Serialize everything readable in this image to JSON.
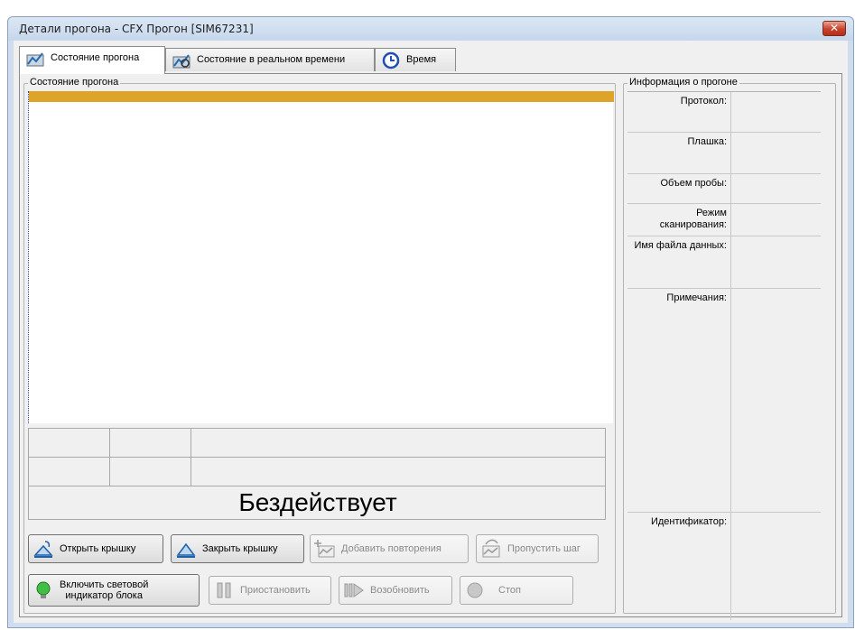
{
  "window": {
    "title": "Детали прогона - CFX Прогон [SIM67231]",
    "close_glyph": "✕"
  },
  "tabs": [
    {
      "label": "Состояние прогона",
      "icon": "run-status-icon",
      "active": true
    },
    {
      "label": "Состояние в реальном времени",
      "icon": "realtime-status-icon",
      "active": false
    },
    {
      "label": "Время",
      "icon": "clock-icon",
      "active": false
    }
  ],
  "status_group": {
    "title": "Состояние прогона",
    "bar_color": "#dea42a",
    "state_text": "Бездействует"
  },
  "buttons": {
    "open_lid": "Открыть крышку",
    "close_lid": "Закрыть крышку",
    "add_repeats": "Добавить повторения",
    "skip_step": "Пропустить шаг",
    "block_light": "Включить световой индикатор блока",
    "block_light_line1": "Включить световой",
    "block_light_line2": "индикатор блока",
    "pause": "Приостановить",
    "resume": "Возобновить",
    "stop": "Стоп"
  },
  "info_group": {
    "title": "Информация о прогоне",
    "rows": [
      {
        "label": "Протокол:",
        "value": ""
      },
      {
        "label": "Плашка:",
        "value": ""
      },
      {
        "label": "Объем пробы:",
        "value": ""
      },
      {
        "label": "Режим сканирования:",
        "value": ""
      },
      {
        "label": "Имя файла данных:",
        "value": ""
      },
      {
        "label": "Примечания:",
        "value": ""
      },
      {
        "label": "Идентификатор:",
        "value": ""
      }
    ]
  }
}
